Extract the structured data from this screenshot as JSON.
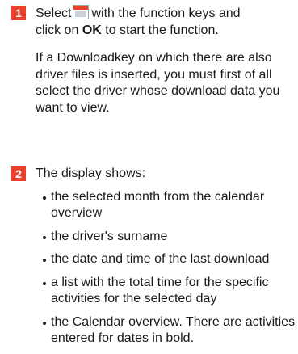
{
  "step1": {
    "number": "1",
    "text_before_icon": "Select",
    "icon": "calendar-icon",
    "text_after_icon": "with the function keys and",
    "line2_before_ok": "click on",
    "ok_label": "OK",
    "line2_after_ok": "to start the function.",
    "paragraph2": "If a Downloadkey on which there are also driver files is inserted, you must first of all select the driver whose download data you want to view."
  },
  "step2": {
    "number": "2",
    "heading": "The display shows:",
    "bullets": [
      "the selected month from the calendar overview",
      "the driver's surname",
      "the date and time of the last download",
      "a list with the total time for the specific activities for the selected day",
      "the Calendar overview. There are activities entered for dates in bold."
    ]
  },
  "colors": {
    "step_badge": "#e8402a",
    "text": "#1a1a1a"
  }
}
